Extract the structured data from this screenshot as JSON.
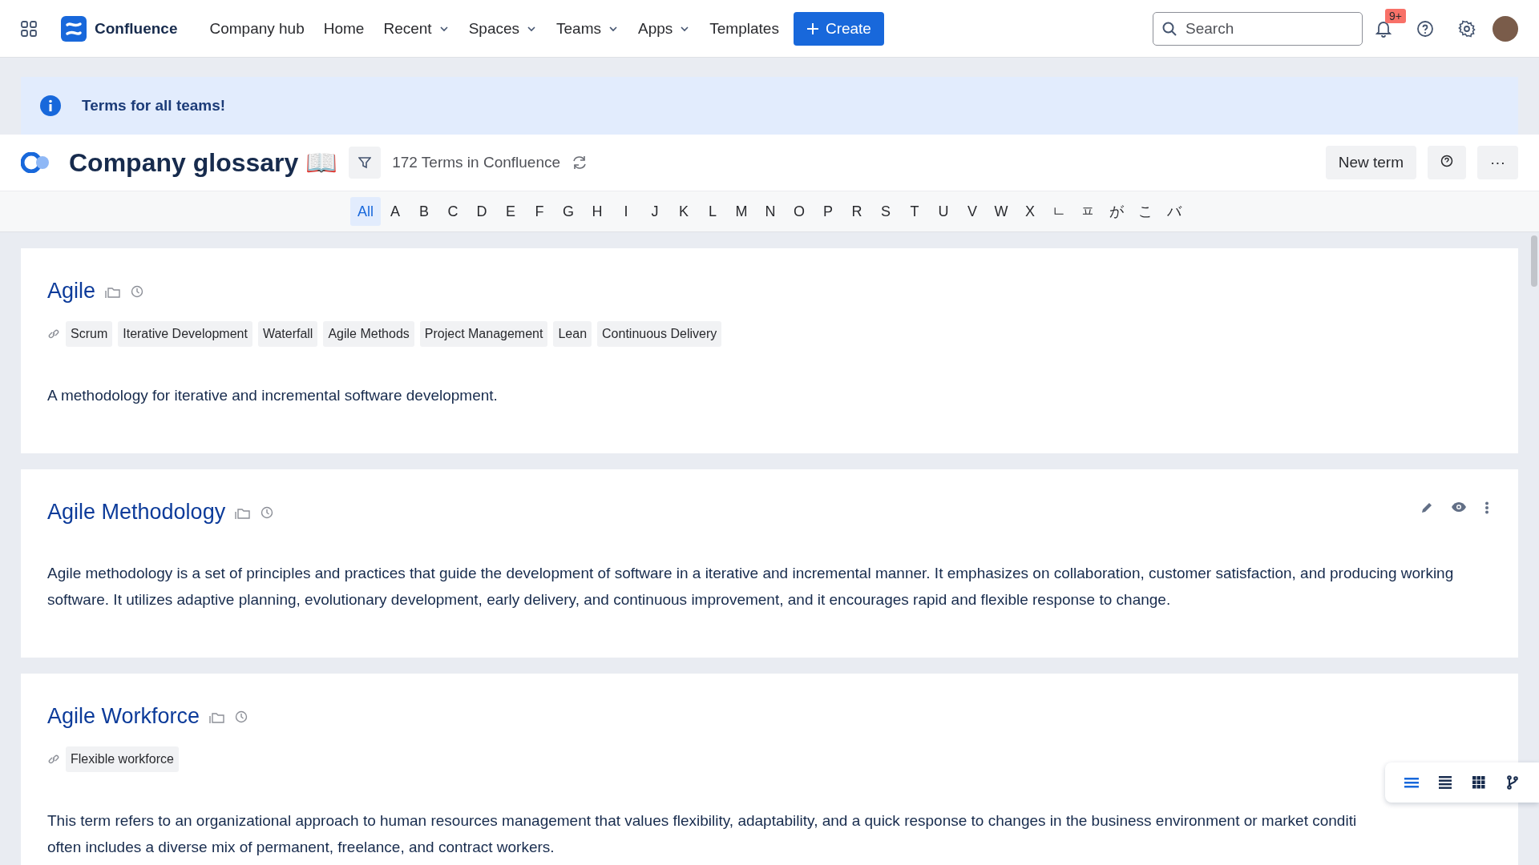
{
  "nav": {
    "product": "Confluence",
    "links": [
      {
        "label": "Company hub",
        "dropdown": false
      },
      {
        "label": "Home",
        "dropdown": false
      },
      {
        "label": "Recent",
        "dropdown": true
      },
      {
        "label": "Spaces",
        "dropdown": true
      },
      {
        "label": "Teams",
        "dropdown": true
      },
      {
        "label": "Apps",
        "dropdown": true
      },
      {
        "label": "Templates",
        "dropdown": false
      }
    ],
    "create": "Create",
    "search": {
      "placeholder": "Search"
    },
    "notifications": "9+"
  },
  "banner": {
    "text": "Terms for all teams!"
  },
  "header": {
    "title": "Company glossary 📖",
    "count": "172 Terms in Confluence",
    "new_term": "New term",
    "more": "···"
  },
  "alphabet": [
    {
      "label": "All",
      "selected": true
    },
    {
      "label": "A",
      "selected": false
    },
    {
      "label": "B",
      "selected": false
    },
    {
      "label": "C",
      "selected": false
    },
    {
      "label": "D",
      "selected": false
    },
    {
      "label": "E",
      "selected": false
    },
    {
      "label": "F",
      "selected": false
    },
    {
      "label": "G",
      "selected": false
    },
    {
      "label": "H",
      "selected": false
    },
    {
      "label": "I",
      "selected": false
    },
    {
      "label": "J",
      "selected": false
    },
    {
      "label": "K",
      "selected": false
    },
    {
      "label": "L",
      "selected": false
    },
    {
      "label": "M",
      "selected": false
    },
    {
      "label": "N",
      "selected": false
    },
    {
      "label": "O",
      "selected": false
    },
    {
      "label": "P",
      "selected": false
    },
    {
      "label": "R",
      "selected": false
    },
    {
      "label": "S",
      "selected": false
    },
    {
      "label": "T",
      "selected": false
    },
    {
      "label": "U",
      "selected": false
    },
    {
      "label": "V",
      "selected": false
    },
    {
      "label": "W",
      "selected": false
    },
    {
      "label": "X",
      "selected": false
    },
    {
      "label": "ㄴ",
      "selected": false
    },
    {
      "label": "ㅍ",
      "selected": false
    },
    {
      "label": "が",
      "selected": false
    },
    {
      "label": "こ",
      "selected": false
    },
    {
      "label": "バ",
      "selected": false
    }
  ],
  "terms": [
    {
      "title": "Agile",
      "hovered": false,
      "tags": [
        "Scrum",
        "Iterative Development",
        "Waterfall",
        "Agile Methods",
        "Project Management",
        "Lean",
        "Continuous Delivery"
      ],
      "description": [
        "A methodology for iterative and incremental software development."
      ]
    },
    {
      "title": "Agile Methodology",
      "hovered": true,
      "description": [
        "Agile methodology is a set of principles and practices that guide the development of software in a iterative and incremental manner. It emphasizes on collaboration, customer satisfaction, and producing working software. It utilizes adaptive planning, evolutionary development, early delivery, and continuous improvement, and it encourages rapid and flexible response to change."
      ]
    },
    {
      "title": "Agile Workforce",
      "hovered": false,
      "tags": [
        "Flexible workforce"
      ],
      "description": [
        "This term refers to an organizational approach to human resources management that values flexibility, adaptability, and a quick response to changes in the business environment or market conditi",
        "often includes a diverse mix of permanent, freelance, and contract workers."
      ]
    }
  ],
  "view_modes": [
    {
      "kind": "compact",
      "selected": true
    },
    {
      "kind": "list",
      "selected": false
    },
    {
      "kind": "grid",
      "selected": false
    },
    {
      "kind": "tree",
      "selected": false
    }
  ]
}
